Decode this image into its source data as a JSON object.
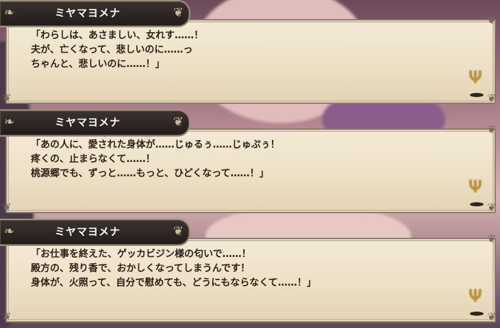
{
  "dialogs": [
    {
      "speaker": "ミヤマヨメナ",
      "lines": [
        "「わらしは、あさましい、女れす……！",
        "夫が、亡くなって、悲しいのに……っ",
        "ちゃんと、悲しいのに……！」"
      ]
    },
    {
      "speaker": "ミヤマヨメナ",
      "lines": [
        "「あの人に、愛された身体が……じゅるぅ……じゅぷぅ！",
        "疼くの、止まらなくて……！",
        "桃源郷でも、ずっと……もっと、ひどくなって……！」"
      ]
    },
    {
      "speaker": "ミヤマヨメナ",
      "lines": [
        "「お仕事を終えた、ゲッカビジン様の匂いで……！",
        "殿方の、残り香で、おかしくなってしまうんです！",
        "身体が、火照って、自分で慰めても、どうにもならなくて……！」"
      ]
    }
  ],
  "icons": {
    "advance": "trident-advance-icon",
    "ornament": "swirl-ornament-icon"
  },
  "colors": {
    "accent": "#c69a22",
    "text": "#2b1f17",
    "nameplate": "#2a2320",
    "box": "#efe3ca"
  }
}
